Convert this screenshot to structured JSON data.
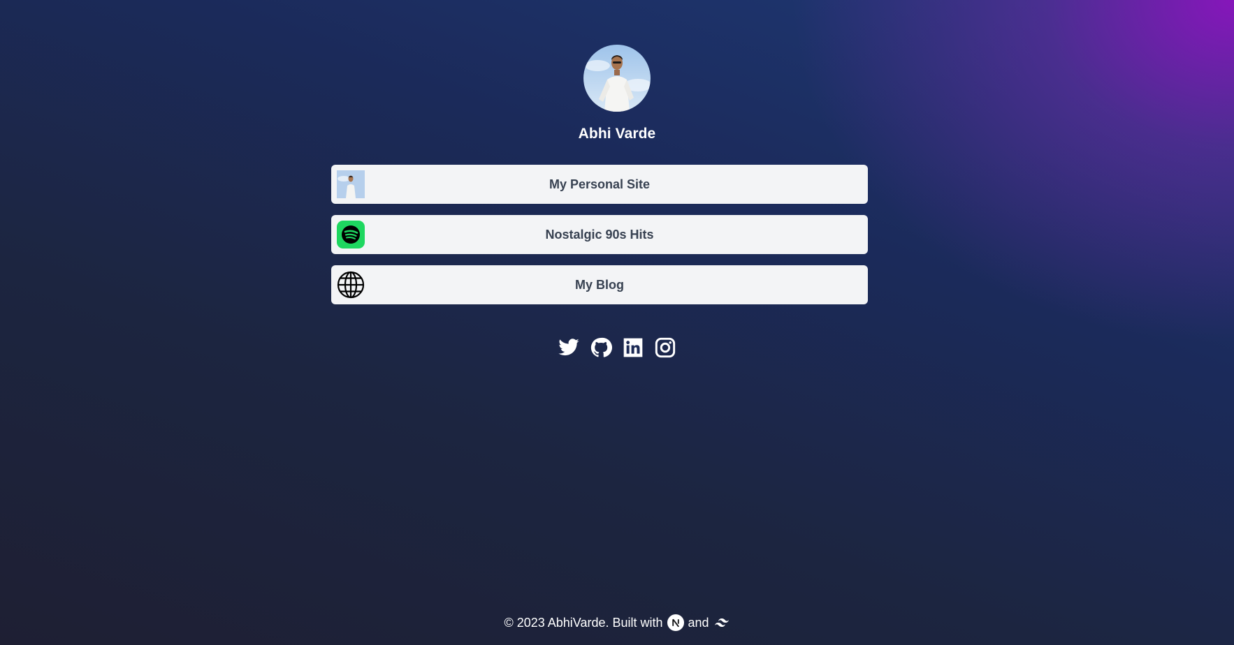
{
  "profile": {
    "name": "Abhi Varde",
    "avatar_icon": "profile-photo"
  },
  "links": [
    {
      "label": "My Personal Site",
      "icon": "profile-photo-thumbnail"
    },
    {
      "label": "Nostalgic 90s Hits",
      "icon": "spotify-icon",
      "icon_color": "#1ed760"
    },
    {
      "label": "My Blog",
      "icon": "globe-icon"
    }
  ],
  "socials": [
    {
      "icon": "twitter-icon"
    },
    {
      "icon": "github-icon"
    },
    {
      "icon": "linkedin-icon"
    },
    {
      "icon": "instagram-icon"
    }
  ],
  "footer": {
    "copyright": "© 2023 AbhiVarde. Built with",
    "and": "and",
    "nextjs_icon": "nextjs-icon",
    "tailwind_icon": "tailwind-icon"
  },
  "colors": {
    "card_bg": "#f3f4f6",
    "card_text": "#374151",
    "accent_purple": "#8a14c0",
    "bg_dark": "#1e1f33"
  }
}
